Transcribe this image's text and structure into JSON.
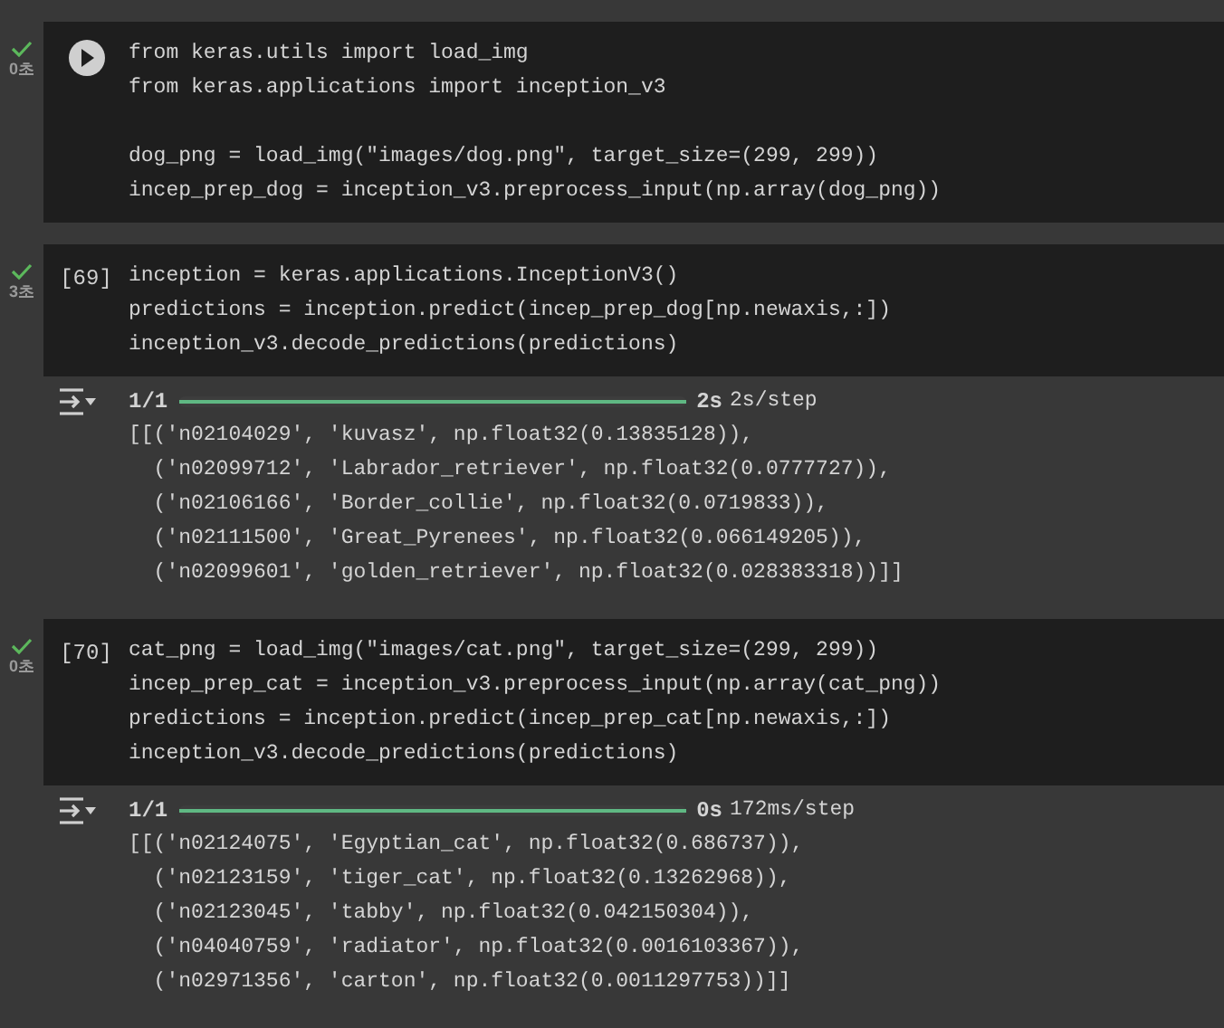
{
  "cells": [
    {
      "status": {
        "done": true,
        "time": "0초"
      },
      "run_button": true,
      "blocks": [
        [
          "from keras.utils import load_img",
          "from keras.applications import inception_v3"
        ],
        [
          "dog_png = load_img(\"images/dog.png\", target_size=(299, 299))",
          "incep_prep_dog = inception_v3.preprocess_input(np.array(dog_png))"
        ]
      ]
    },
    {
      "status": {
        "done": true,
        "time": "3초"
      },
      "count": "[69]",
      "blocks": [
        [
          "inception = keras.applications.InceptionV3()",
          "predictions = inception.predict(incep_prep_dog[np.newaxis,:])",
          "inception_v3.decode_predictions(predictions)"
        ]
      ],
      "output": {
        "progress": {
          "step": "1/1",
          "level": 1,
          "time": "2s",
          "rate": "2s/step"
        },
        "lines": [
          "[[('n02104029', 'kuvasz', np.float32(0.13835128)),",
          "  ('n02099712', 'Labrador_retriever', np.float32(0.0777727)),",
          "  ('n02106166', 'Border_collie', np.float32(0.0719833)),",
          "  ('n02111500', 'Great_Pyrenees', np.float32(0.066149205)),",
          "  ('n02099601', 'golden_retriever', np.float32(0.028383318))]]"
        ]
      }
    },
    {
      "status": {
        "done": true,
        "time": "0초"
      },
      "count": "[70]",
      "blocks": [
        [
          "cat_png = load_img(\"images/cat.png\", target_size=(299, 299))",
          "incep_prep_cat = inception_v3.preprocess_input(np.array(cat_png))",
          "predictions = inception.predict(incep_prep_cat[np.newaxis,:])",
          "inception_v3.decode_predictions(predictions)"
        ]
      ],
      "output": {
        "progress": {
          "step": "1/1",
          "level": 1,
          "time": "0s",
          "rate": "172ms/step"
        },
        "lines": [
          "[[('n02124075', 'Egyptian_cat', np.float32(0.686737)),",
          "  ('n02123159', 'tiger_cat', np.float32(0.13262968)),",
          "  ('n02123045', 'tabby', np.float32(0.042150304)),",
          "  ('n04040759', 'radiator', np.float32(0.0016103367)),",
          "  ('n02971356', 'carton', np.float32(0.0011297753))]]"
        ]
      }
    }
  ]
}
